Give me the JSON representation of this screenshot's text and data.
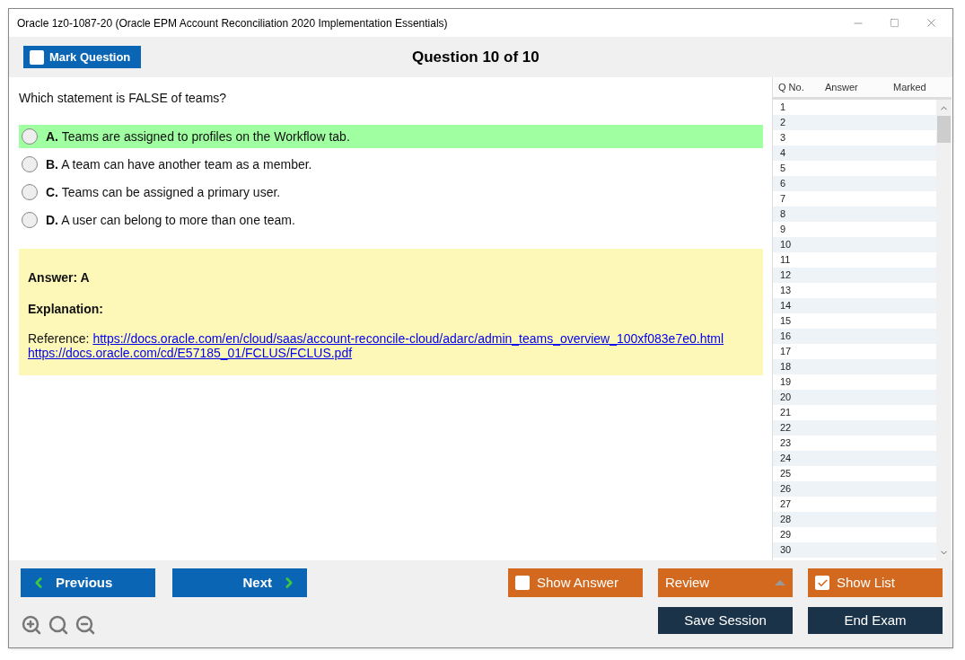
{
  "window": {
    "title": "Oracle 1z0-1087-20 (Oracle EPM Account Reconciliation 2020 Implementation Essentials)"
  },
  "toolbar": {
    "mark_question": {
      "label": "Mark Question",
      "checked": false
    },
    "heading": "Question 10 of 10"
  },
  "question": {
    "text": "Which statement is FALSE of teams?",
    "options": [
      {
        "letter": "A.",
        "text": "Teams are assigned to profiles on the Workflow tab.",
        "selected": false,
        "highlighted": true
      },
      {
        "letter": "B.",
        "text": "A team can have another team as a member.",
        "selected": false,
        "highlighted": false
      },
      {
        "letter": "C.",
        "text": "Teams can be assigned a primary user.",
        "selected": false,
        "highlighted": false
      },
      {
        "letter": "D.",
        "text": "A user can belong to more than one team.",
        "selected": false,
        "highlighted": false
      }
    ]
  },
  "answer_panel": {
    "answer": "Answer: A",
    "explanation": "Explanation:",
    "reference_label": "Reference:",
    "links": [
      "https://docs.oracle.com/en/cloud/saas/account-reconcile-cloud/adarc/admin_teams_overview_100xf083e7e0.html",
      "https://docs.oracle.com/cd/E57185_01/FCLUS/FCLUS.pdf"
    ]
  },
  "question_list": {
    "columns": [
      "Q No.",
      "Answer",
      "Marked"
    ],
    "rows": [
      "1",
      "2",
      "3",
      "4",
      "5",
      "6",
      "7",
      "8",
      "9",
      "10",
      "11",
      "12",
      "13",
      "14",
      "15",
      "16",
      "17",
      "18",
      "19",
      "20",
      "21",
      "22",
      "23",
      "24",
      "25",
      "26",
      "27",
      "28",
      "29",
      "30"
    ]
  },
  "footer": {
    "previous": "Previous",
    "next": "Next",
    "show_answer": {
      "label": "Show Answer",
      "checked": false
    },
    "review": "Review",
    "show_list": {
      "label": "Show List",
      "checked": true
    },
    "save_session": "Save Session",
    "end_exam": "End Exam"
  }
}
